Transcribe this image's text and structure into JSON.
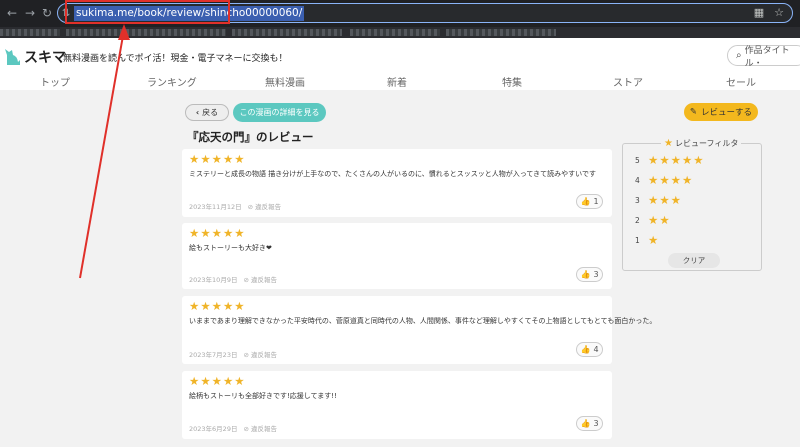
{
  "browser": {
    "url": "sukima.me/book/review/shincho00000060/"
  },
  "site": {
    "logo_text": "スキマ",
    "tagline": "無料漫画を読んでポイ活！現金・電子マネーに交換も！",
    "search_placeholder": "作品タイトル・"
  },
  "nav": {
    "items": [
      "トップ",
      "ランキング",
      "無料漫画",
      "新着",
      "特集",
      "ストア",
      "セール"
    ]
  },
  "actions": {
    "back_label": "戻る",
    "detail_label": "この漫画の詳細を見る",
    "write_review_label": "レビューする"
  },
  "page_title": "『応天の門』のレビュー",
  "reviews": [
    {
      "stars": 5,
      "text": "ミステリーと成長の物語 描き分けが上手なので、たくさんの人がいるのに、慣れるとスッスッと人物が入ってきて読みやすいです",
      "date": "2023年11月12日",
      "report": "違反報告",
      "likes": "1"
    },
    {
      "stars": 5,
      "text": "絵もストーリーも大好き❤",
      "date": "2023年10月9日",
      "report": "違反報告",
      "likes": "3"
    },
    {
      "stars": 5,
      "text": "いままであまり理解できなかった平安時代の、菅原道真と同時代の人物、人間関係、事件など理解しやすくてその上物語としてもとても面白かった。",
      "date": "2023年7月23日",
      "report": "違反報告",
      "likes": "4"
    },
    {
      "stars": 5,
      "text": "絵柄もストーリも全部好きです!応援してます!!",
      "date": "2023年6月29日",
      "report": "違反報告",
      "likes": "3"
    }
  ],
  "filter": {
    "title": "レビューフィルタ",
    "rows": [
      {
        "label": "5",
        "stars": 5
      },
      {
        "label": "4",
        "stars": 4
      },
      {
        "label": "3",
        "stars": 3
      },
      {
        "label": "2",
        "stars": 2
      },
      {
        "label": "1",
        "stars": 1
      }
    ],
    "clear_label": "クリア"
  },
  "colors": {
    "star": "#f0b429",
    "teal": "#5cc8c0",
    "yellow": "#f3b81e",
    "annotation_red": "#e0302a"
  }
}
